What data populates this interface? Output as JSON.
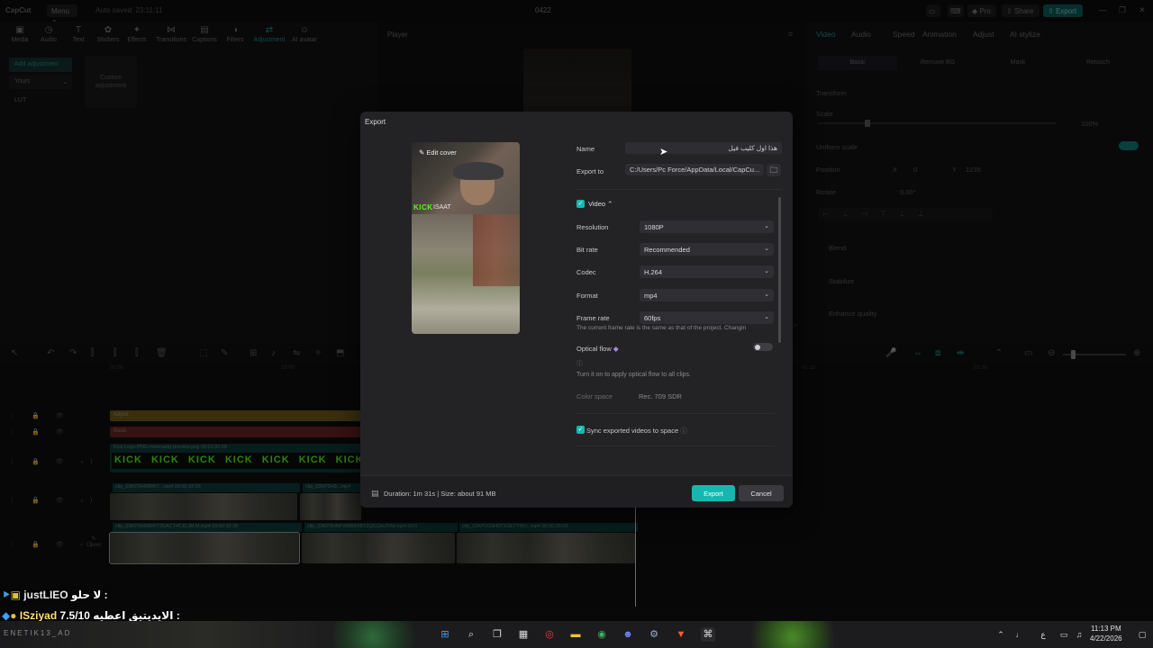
{
  "titlebar": {
    "logo": "CapCut",
    "menu": "Menu",
    "autosave": "Auto saved: 23:11:11",
    "project_title": "0422",
    "pro": "Pro",
    "share": "Share",
    "export": "Export"
  },
  "tools": [
    "Media",
    "Audio",
    "Text",
    "Stickers",
    "Effects",
    "Transitions",
    "Captions",
    "Filters",
    "Adjustment",
    "AI avatar"
  ],
  "left_panel": {
    "add_adjustment": "Add adjustment",
    "yours": "Yours",
    "lut": "LUT",
    "custom": "Custom adjustment"
  },
  "player": {
    "title": "Player"
  },
  "right_panel": {
    "tabs": [
      "Video",
      "Audio",
      "Speed",
      "Animation",
      "Adjust",
      "AI stylize"
    ],
    "subtabs": [
      "Basic",
      "Remove BG",
      "Mask",
      "Retouch"
    ],
    "transform": "Transform",
    "scale": "Scale",
    "scale_value": "100%",
    "uniform_scale": "Uniform scale",
    "position": "Position",
    "pos_x_label": "X",
    "pos_x": "0",
    "pos_y_label": "Y",
    "pos_y": "1235",
    "rotate": "Rotate",
    "rotate_value": "0.00°",
    "blend": "Blend",
    "stabilize": "Stabilize",
    "enhance_quality": "Enhance quality"
  },
  "timeline": {
    "ruler": [
      "00:00",
      "10:00",
      "01:10",
      "01:30"
    ],
    "tracks": {
      "adjust": "Adjust",
      "basic": "Basic",
      "sticker_clip": "Kick-Logo-PNG-mmmaeig-preview.png  00:01:30:29",
      "clip1": "clip_03KP2H98RR7...mp4  00:00:32:26",
      "clip2": "clip_03KP2H9...mp4",
      "main1": "clip_03KP2H98RR7JGACT4TJCJM.M.mp4  00:00:32:26",
      "main2": "clip_03KP2HNFXWB6XBTZQGQHZNW.mp4  00:0",
      "main3": "clip_03KP2G9HDTK3ETYMV...mp4  00:00:35:03",
      "cover": "Cover"
    },
    "kick_label": "KICK"
  },
  "dialog": {
    "title": "Export",
    "edit_cover": "Edit cover",
    "cover_kick": "KICK",
    "cover_name": "ISAAT",
    "name_label": "Name",
    "name_value": "هذا اول كليب فيل",
    "export_to_label": "Export to",
    "export_to_value": "C:/Users/Pc Force/AppData/Local/CapCu...",
    "video_label": "Video",
    "resolution_label": "Resolution",
    "resolution": "1080P",
    "bitrate_label": "Bit rate",
    "bitrate": "Recommended",
    "codec_label": "Codec",
    "codec": "H.264",
    "format_label": "Format",
    "format": "mp4",
    "framerate_label": "Frame rate",
    "framerate": "60fps",
    "framerate_note": "The current frame rate is the same as that of the project. Changin",
    "optical_flow_label": "Optical flow",
    "optical_flow_note": "Turn it on to apply optical flow to all clips.",
    "color_space_label": "Color space",
    "color_space": "Rec. 709 SDR",
    "sync_label": "Sync exported videos to space",
    "footer_info": "Duration: 1m 31s | Size: about 91 MB",
    "export_button": "Export",
    "cancel_button": "Cancel"
  },
  "chat": [
    {
      "user": "justLIEO",
      "message": "لا حلو :"
    },
    {
      "user": "ISziyad",
      "message": "الايديتيق اعطيه 7.5/10 :"
    }
  ],
  "channel_watermark": "ENETIK13_AD",
  "taskbar": {
    "time": "11:13 PM",
    "date": "4/22/2026",
    "lang": "ع"
  },
  "colors": {
    "accent": "#17b7b0",
    "kick_green": "#53fc18",
    "dialog_bg": "#232326"
  }
}
